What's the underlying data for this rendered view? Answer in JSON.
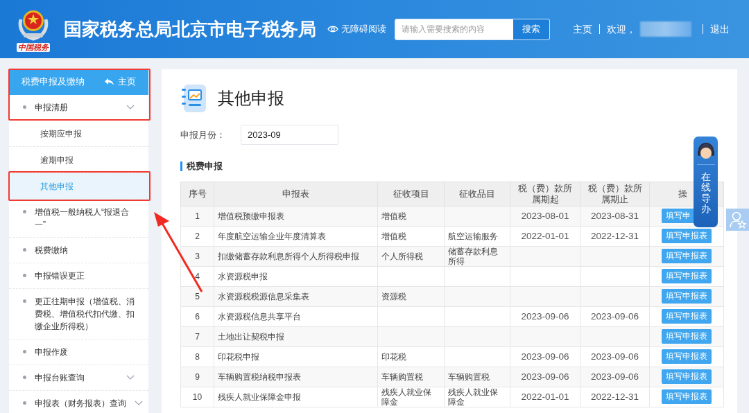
{
  "header": {
    "logo_text": "中国税务",
    "title": "国家税务总局北京市电子税务局",
    "accessibility": "无障碍阅读",
    "search": {
      "placeholder": "请输入需要搜索的内容",
      "button": "搜索"
    },
    "home": "主页",
    "welcome": "欢迎，",
    "logout": "退出"
  },
  "sidebar": {
    "title": "税费申报及缴纳",
    "home": "主页",
    "items": [
      {
        "label": "申报清册",
        "kind": "folder",
        "children": [
          {
            "label": "按期应申报",
            "selected": false
          },
          {
            "label": "逾期申报",
            "selected": false
          },
          {
            "label": "其他申报",
            "selected": true
          }
        ]
      },
      {
        "label": "增值税一般纳税人“报退合一”",
        "kind": "link"
      },
      {
        "label": "税费缴纳",
        "kind": "link"
      },
      {
        "label": "申报错误更正",
        "kind": "link"
      },
      {
        "label": "更正往期申报（增值税、消费税、增值税代扣代缴、扣缴企业所得税）",
        "kind": "link"
      },
      {
        "label": "申报作废",
        "kind": "link"
      },
      {
        "label": "申报台账查询",
        "kind": "folder"
      },
      {
        "label": "申报表（财务报表）查询",
        "kind": "folder"
      }
    ]
  },
  "page": {
    "title": "其他申报",
    "month_label": "申报月份：",
    "month_value": "2023-09",
    "section": "税费申报",
    "table": {
      "columns": [
        "序号",
        "申报表",
        "征收项目",
        "征收品目",
        "税（费）款所属期起",
        "税（费）款所属期止",
        "操"
      ],
      "rows": [
        {
          "cells": [
            "1",
            "增值税预缴申报表",
            "增值税",
            "",
            "2023-08-01",
            "2023-08-31"
          ],
          "action": "填写申"
        },
        {
          "cells": [
            "2",
            "年度航空运输企业年度清算表",
            "增值税",
            "航空运输服务",
            "2022-01-01",
            "2022-12-31"
          ],
          "action": "填写申报表"
        },
        {
          "cells": [
            "3",
            "扣缴储蓄存款利息所得个人所得税申报",
            "个人所得税",
            "储蓄存款利息所得",
            "",
            ""
          ],
          "action": "填写申报表"
        },
        {
          "cells": [
            "4",
            "水资源税申报",
            "",
            "",
            "",
            ""
          ],
          "action": "填写申报表"
        },
        {
          "cells": [
            "5",
            "水资源税税源信息采集表",
            "资源税",
            "",
            "",
            ""
          ],
          "action": "填写申报表"
        },
        {
          "cells": [
            "6",
            "水资源税信息共享平台",
            "",
            "",
            "2023-09-06",
            "2023-09-06"
          ],
          "action": "填写申报表"
        },
        {
          "cells": [
            "7",
            "土地出让契税申报",
            "",
            "",
            "",
            ""
          ],
          "action": "填写申报表"
        },
        {
          "cells": [
            "8",
            "印花税申报",
            "印花税",
            "",
            "2023-09-06",
            "2023-09-06"
          ],
          "action": "填写申报表"
        },
        {
          "cells": [
            "9",
            "车辆购置税纳税申报表",
            "车辆购置税",
            "车辆购置税",
            "2023-09-06",
            "2023-09-06"
          ],
          "action": "填写申报表"
        },
        {
          "cells": [
            "10",
            "残疾人就业保障金申报",
            "残疾人就业保障金",
            "残疾人就业保障金",
            "2022-01-01",
            "2022-12-31"
          ],
          "action": "填写申报表"
        }
      ]
    }
  },
  "widget": {
    "label": "在线导办"
  }
}
